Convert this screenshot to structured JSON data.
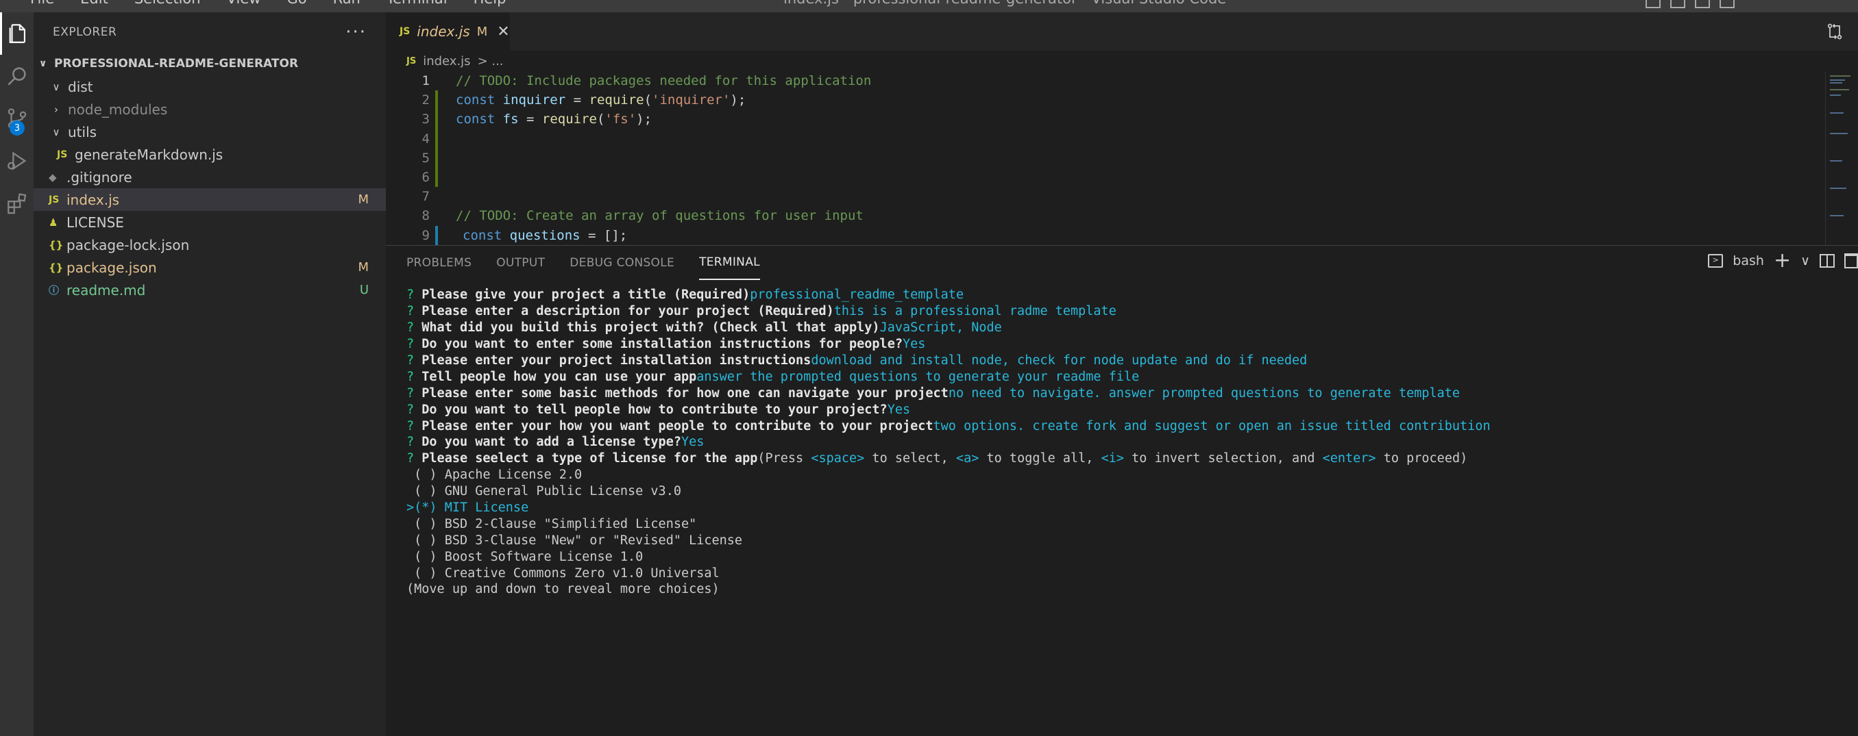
{
  "titlebar": {
    "menu": [
      "File",
      "Edit",
      "Selection",
      "View",
      "Go",
      "Run",
      "Terminal",
      "Help"
    ],
    "window_title": "index.js - professional-readme-generator - Visual Studio Code"
  },
  "activity_bar": {
    "source_control_badge": "3"
  },
  "sidebar": {
    "header": "EXPLORER",
    "more": "···",
    "project": "PROFESSIONAL-README-GENERATOR",
    "items": [
      {
        "label": "dist",
        "type": "folder",
        "expanded": true,
        "status": ""
      },
      {
        "label": "node_modules",
        "type": "folder",
        "expanded": false,
        "status": ""
      },
      {
        "label": "utils",
        "type": "folder",
        "expanded": true,
        "status": ""
      },
      {
        "label": "generateMarkdown.js",
        "type": "js",
        "status": ""
      },
      {
        "label": ".gitignore",
        "type": "git",
        "status": ""
      },
      {
        "label": "index.js",
        "type": "js",
        "status": "M"
      },
      {
        "label": "LICENSE",
        "type": "license",
        "status": ""
      },
      {
        "label": "package-lock.json",
        "type": "json",
        "status": ""
      },
      {
        "label": "package.json",
        "type": "json",
        "status": "M"
      },
      {
        "label": "readme.md",
        "type": "info",
        "status": "U"
      }
    ]
  },
  "editor": {
    "tab": {
      "icon": "JS",
      "name": "index.js",
      "status": "M",
      "close": "✕"
    },
    "breadcrumb": {
      "icon": "JS",
      "file": "index.js",
      "rest": "> ..."
    },
    "lines": [
      "1",
      "2",
      "3",
      "4",
      "5",
      "6",
      "7",
      "8",
      "9"
    ],
    "code": {
      "l1": "// TODO: Include packages needed for this application",
      "l2_kw": "const",
      "l2_var": "inquirer",
      "l2_eq": " = ",
      "l2_fn": "require",
      "l2_open": "(",
      "l2_str": "'inquirer'",
      "l2_close": ");",
      "l3_kw": "const",
      "l3_var": "fs",
      "l3_eq": " = ",
      "l3_fn": "require",
      "l3_open": "(",
      "l3_str": "'fs'",
      "l3_close": ");",
      "l8": "// TODO: Create an array of questions for user input",
      "l9_kw": "const",
      "l9_var": "questions",
      "l9_rest": " = [];"
    }
  },
  "panel": {
    "tabs": [
      "PROBLEMS",
      "OUTPUT",
      "DEBUG CONSOLE",
      "TERMINAL"
    ],
    "active_tab": "TERMINAL",
    "shell": "bash",
    "terminal": {
      "qa": [
        {
          "q": "Please give your project a title (Required)",
          "a": "professional_readme_template"
        },
        {
          "q": "Please enter a description for your project (Required)",
          "a": "this is a professional radme template"
        },
        {
          "q": "What did you build this project with? (Check all that apply)",
          "a": "JavaScript, Node"
        },
        {
          "q": "Do you want to enter some installation instructions for people?",
          "a": "Yes"
        },
        {
          "q": "Please enter your project installation instructions",
          "a": "download and install node, check for node update and do if needed"
        },
        {
          "q": "Tell people how you can use your app",
          "a": "answer the prompted questions to generate your readme file"
        },
        {
          "q": "Please enter some basic methods for how one can navigate your project",
          "a": "no need to navigate. answer prompted questions to generate template"
        },
        {
          "q": "Do you want to tell people how to contribute to your project?",
          "a": "Yes"
        },
        {
          "q": "Please enter your how you want people to contribute to your project",
          "a": "two options. create fork and suggest or open an issue titled contribution"
        },
        {
          "q": "Do you want to add a license type?",
          "a": "Yes"
        }
      ],
      "license_q": "Please seelect a type of license for the app",
      "license_hint": {
        "p1": "(Press ",
        "k1": "<space>",
        "p2": " to select, ",
        "k2": "<a>",
        "p3": " to toggle all, ",
        "k3": "<i>",
        "p4": " to invert selection, and ",
        "k4": "<enter>",
        "p5": " to proceed)"
      },
      "options": [
        {
          "text": " ( ) Apache License 2.0",
          "selected": false
        },
        {
          "text": " ( ) GNU General Public License v3.0",
          "selected": false
        },
        {
          "text": ">(*) MIT License",
          "selected": true
        },
        {
          "text": " ( ) BSD 2-Clause \"Simplified License\"",
          "selected": false
        },
        {
          "text": " ( ) BSD 3-Clause \"New\" or \"Revised\" License",
          "selected": false
        },
        {
          "text": " ( ) Boost Software License 1.0",
          "selected": false
        },
        {
          "text": " ( ) Creative Commons Zero v1.0 Universal",
          "selected": false
        }
      ],
      "footer": "(Move up and down to reveal more choices)"
    }
  }
}
